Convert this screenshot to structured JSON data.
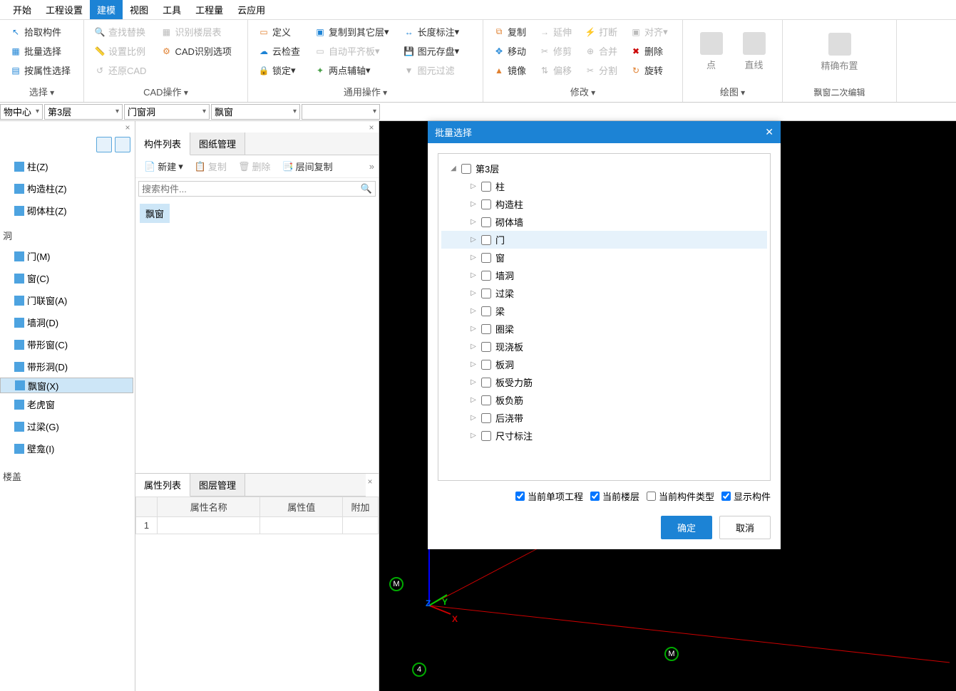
{
  "menu": {
    "items": [
      "开始",
      "工程设置",
      "建模",
      "视图",
      "工具",
      "工程量",
      "云应用"
    ],
    "active": 2
  },
  "ribbon": {
    "g0": {
      "title": "选择",
      "btns": [
        "拾取构件",
        "批量选择",
        "按属性选择"
      ]
    },
    "g1": {
      "title": "CAD操作",
      "c0": [
        "查找替换",
        "设置比例",
        "还原CAD"
      ],
      "c1": [
        "识别楼层表",
        "CAD识别选项"
      ]
    },
    "g2": {
      "title": "通用操作",
      "c0": [
        "定义",
        "云检查",
        "锁定"
      ],
      "c1": [
        "复制到其它层",
        "自动平齐板",
        "两点辅轴"
      ],
      "c2": [
        "长度标注",
        "图元存盘",
        "图元过滤"
      ]
    },
    "g3": {
      "title": "修改",
      "c0": [
        "复制",
        "移动",
        "镜像"
      ],
      "c1": [
        "延伸",
        "修剪",
        "偏移"
      ],
      "c2": [
        "打断",
        "合并",
        "分割"
      ],
      "c3": [
        "对齐",
        "删除",
        "旋转"
      ]
    },
    "g4": {
      "title": "绘图",
      "btns": [
        "点",
        "直线"
      ]
    },
    "g5": {
      "title": "飘窗二次编辑",
      "btn": "精确布置"
    }
  },
  "selectors": {
    "s0": "物中心",
    "s1": "第3层",
    "s2": "门窗洞",
    "s3": "飘窗",
    "s4": ""
  },
  "leftTree": {
    "g0": [
      "柱(Z)",
      "构造柱(Z)",
      "砌体柱(Z)"
    ],
    "g1label": "洞",
    "g1": [
      "门(M)",
      "窗(C)",
      "门联窗(A)",
      "墙洞(D)",
      "带形窗(C)",
      "带形洞(D)",
      "飘窗(X)",
      "老虎窗",
      "过梁(G)",
      "壁龛(I)"
    ],
    "g2": "楼盖",
    "selected": "飘窗(X)"
  },
  "mid": {
    "tabs": [
      "构件列表",
      "图纸管理"
    ],
    "tbbtns": [
      "新建",
      "复制",
      "删除",
      "层间复制"
    ],
    "searchPlaceholder": "搜索构件...",
    "chip": "飘窗",
    "propTabs": [
      "属性列表",
      "图层管理"
    ],
    "propCols": [
      "",
      "属性名称",
      "属性值",
      "附加"
    ],
    "propRow": "1"
  },
  "dialog": {
    "title": "批量选择",
    "root": "第3层",
    "items": [
      "柱",
      "构造柱",
      "砌体墙",
      "门",
      "窗",
      "墙洞",
      "过梁",
      "梁",
      "圈梁",
      "现浇板",
      "板洞",
      "板受力筋",
      "板负筋",
      "后浇带",
      "尺寸标注"
    ],
    "hlIndex": 3,
    "opts": [
      "当前单项工程",
      "当前楼层",
      "当前构件类型",
      "显示构件"
    ],
    "optChecked": [
      true,
      true,
      false,
      true
    ],
    "ok": "确定",
    "cancel": "取消"
  },
  "axes": {
    "x": "X",
    "y": "Y",
    "z": "Z"
  }
}
